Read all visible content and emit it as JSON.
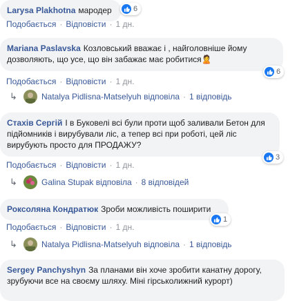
{
  "comments": [
    {
      "author": "Larysa Plakhotna",
      "text": "мародер",
      "likes": "6",
      "actions": {
        "like": "Подобається",
        "reply": "Відповісти",
        "time": "1 дн."
      }
    },
    {
      "author": "Mariana Paslavska",
      "text": "Козловський вважає і , найголовніше йому дозволяють, що усе, що він забажає має робитися🙎",
      "likes": "6",
      "actions": {
        "like": "Подобається",
        "reply": "Відповісти",
        "time": "1 дн."
      },
      "reply_summary": {
        "name": "Natalya Pidlisna-Matselyuh",
        "verb": "відповіла",
        "count": "1 відповідь"
      }
    },
    {
      "author": "Стахів Сергій",
      "text": "І в Буковелі всі були проти щоб заливали Бетон для підйомників і вирубували ліс, а тепер всі при роботі, цей ліс вирубують просто для ПРОДАЖУ?",
      "likes": "3",
      "actions": {
        "like": "Подобається",
        "reply": "Відповісти",
        "time": "1 дн."
      },
      "reply_summary": {
        "name": "Galina Stupak",
        "verb": "відповіла",
        "count": "8 відповідей"
      }
    },
    {
      "author": "Роксоляна Кондратюк",
      "text": "Зроби можливість поширити",
      "likes": "1",
      "actions": {
        "like": "Подобається",
        "reply": "Відповісти",
        "time": "1 дн."
      },
      "reply_summary": {
        "name": "Natalya Pidlisna-Matselyuh",
        "verb": "відповіла",
        "count": "1 відповідь"
      }
    },
    {
      "author": "Sergey Panchyshyn",
      "text": "За планами він хоче зробити канатну дорогу, зрубуючи все на своєму шляху. Міні гірськолижний курорт)"
    }
  ],
  "colors": {
    "link": "#385898",
    "bubble": "#f2f3f5",
    "like_blue": "#1877f2"
  },
  "icons": {
    "like": "thumbs-up-icon",
    "reply_arrow": "reply-arrow-icon"
  }
}
